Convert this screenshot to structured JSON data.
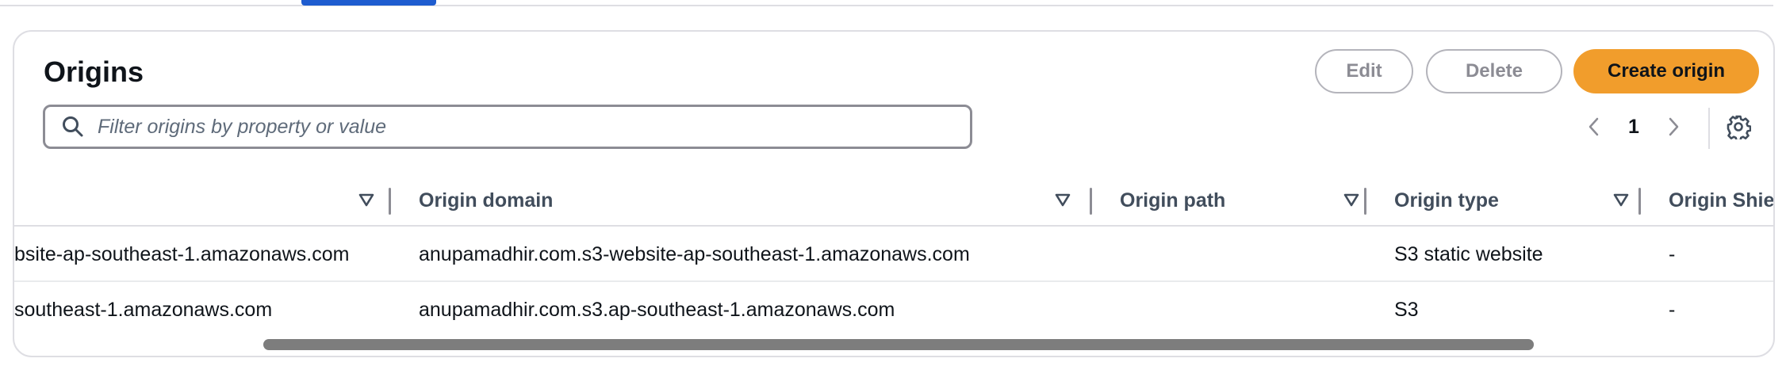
{
  "panel": {
    "title": "Origins",
    "buttons": {
      "edit": "Edit",
      "delete": "Delete",
      "create": "Create origin"
    },
    "filter": {
      "placeholder": "Filter origins by property or value"
    },
    "pagination": {
      "current_page": "1"
    }
  },
  "table": {
    "columns": [
      {
        "label": ""
      },
      {
        "label": "Origin domain"
      },
      {
        "label": "Origin path"
      },
      {
        "label": "Origin type"
      },
      {
        "label": "Origin Shie"
      }
    ],
    "rows": [
      {
        "name": "bsite-ap-southeast-1.amazonaws.com",
        "domain": "anupamadhir.com.s3-website-ap-southeast-1.amazonaws.com",
        "path": "",
        "type": "S3 static website",
        "shield": "-"
      },
      {
        "name": "southeast-1.amazonaws.com",
        "domain": "anupamadhir.com.s3.ap-southeast-1.amazonaws.com",
        "path": "",
        "type": "S3",
        "shield": "-"
      }
    ]
  },
  "icons": {
    "search": "search-icon",
    "prev": "chevron-left-icon",
    "next": "chevron-right-icon",
    "settings": "gear-icon",
    "sort": "caret-down-icon"
  }
}
